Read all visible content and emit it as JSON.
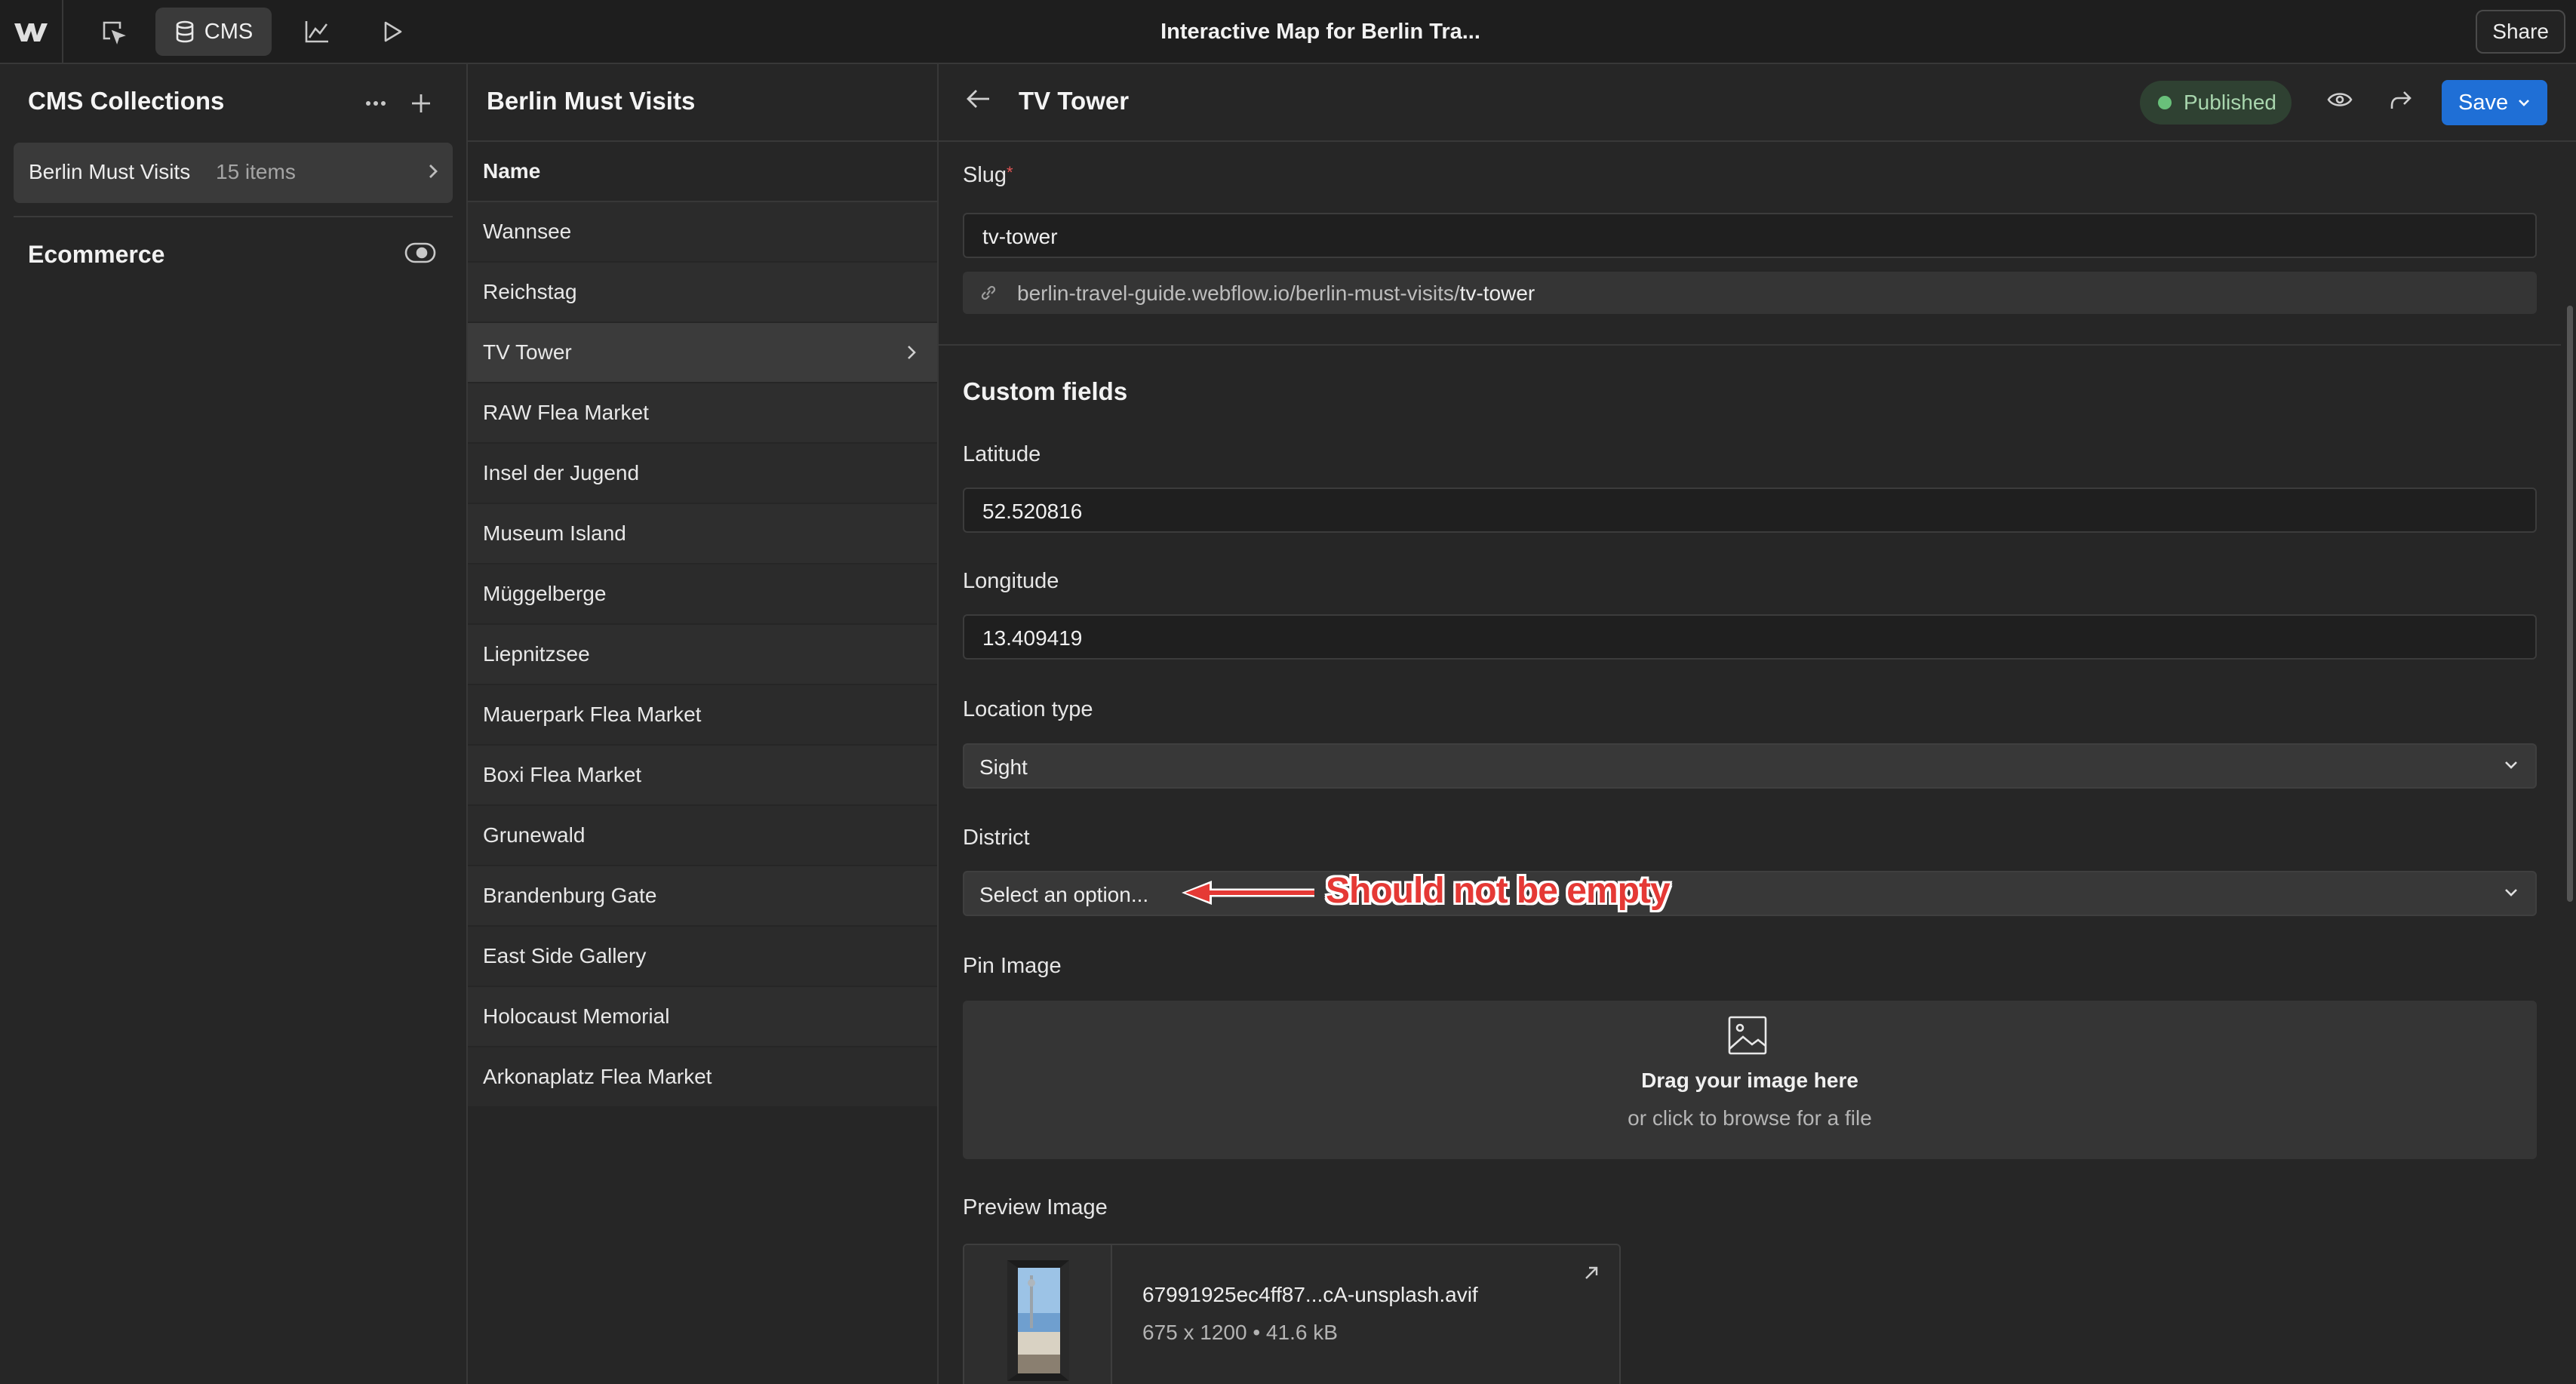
{
  "topbar": {
    "logo_icon": "webflow-logo-icon",
    "cms_label": "CMS",
    "title": "Interactive Map for Berlin Tra...",
    "share_label": "Share"
  },
  "collections_panel": {
    "title": "CMS Collections",
    "collection": {
      "name": "Berlin Must Visits",
      "count": "15 items"
    },
    "ecommerce_label": "Ecommerce"
  },
  "items_panel": {
    "title": "Berlin Must Visits",
    "column_header": "Name",
    "items": [
      "Wannsee",
      "Reichstag",
      "TV Tower",
      "RAW Flea Market",
      "Insel der Jugend",
      "Museum Island",
      "Müggelberge",
      "Liepnitzsee",
      "Mauerpark Flea Market",
      "Boxi Flea Market",
      "Grunewald",
      "Brandenburg Gate",
      "East Side Gallery",
      "Holocaust Memorial",
      "Arkonaplatz Flea Market"
    ],
    "selected_index": 2
  },
  "editor": {
    "title": "TV Tower",
    "status": "Published",
    "status_color": "#69c07a",
    "save_label": "Save",
    "accent": "#1f6fd6",
    "slug_label": "Slug",
    "required_mark": "*",
    "slug_value": "tv-tower",
    "url_prefix": "berlin-travel-guide.webflow.io/berlin-must-visits/",
    "url_slug": "tv-tower",
    "custom_fields_title": "Custom fields",
    "latitude_label": "Latitude",
    "latitude_value": "52.520816",
    "longitude_label": "Longitude",
    "longitude_value": "13.409419",
    "location_type_label": "Location type",
    "location_type_value": "Sight",
    "district_label": "District",
    "district_placeholder": "Select an option...",
    "annotation": "Should not be empty",
    "annotation_color": "#e53935",
    "pin_image_label": "Pin Image",
    "dropzone_title": "Drag your image here",
    "dropzone_sub": "or click to browse for a file",
    "preview_image_label": "Preview Image",
    "preview_file_name": "67991925ec4ff87...cA-unsplash.avif",
    "preview_file_meta": "675 x 1200 • 41.6 kB"
  }
}
